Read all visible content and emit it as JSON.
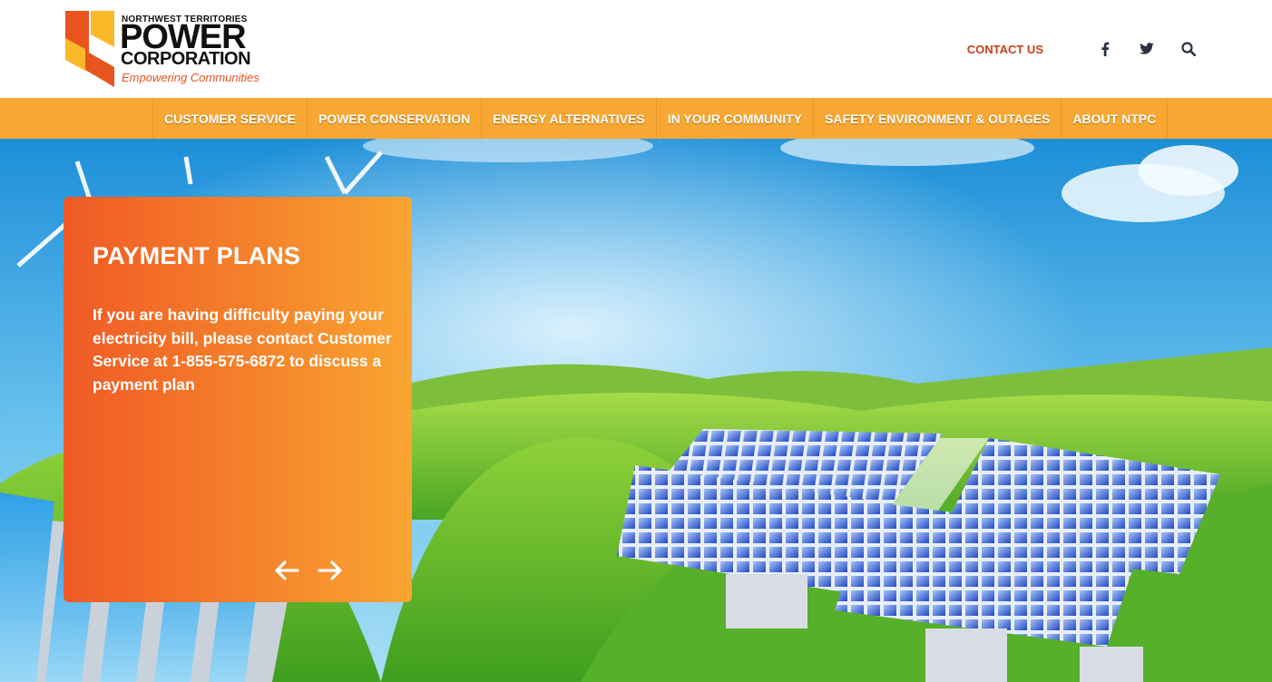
{
  "brand": {
    "line1": "NORTHWEST TERRITORIES",
    "line2": "POWER",
    "line3": "CORPORATION",
    "tagline": "Empowering Communities",
    "colors": {
      "orange": "#f8a832",
      "red_orange": "#e8541e",
      "yellow": "#fbb829"
    }
  },
  "header": {
    "contact_label": "CONTACT US",
    "icons": [
      "facebook-icon",
      "twitter-icon",
      "search-icon"
    ]
  },
  "nav": {
    "items": [
      {
        "label": "CUSTOMER SERVICE"
      },
      {
        "label": "POWER CONSERVATION"
      },
      {
        "label": "ENERGY ALTERNATIVES"
      },
      {
        "label": "IN YOUR COMMUNITY"
      },
      {
        "label": "SAFETY ENVIRONMENT & OUTAGES"
      },
      {
        "label": "ABOUT NTPC"
      }
    ]
  },
  "hero": {
    "slide": {
      "title": "PAYMENT PLANS",
      "body": "If you are having difficulty paying your electricity bill, please contact Customer Service at 1-855-575-6872 to discuss a payment plan"
    },
    "controls": [
      "arrow-left-icon",
      "arrow-right-icon"
    ]
  }
}
